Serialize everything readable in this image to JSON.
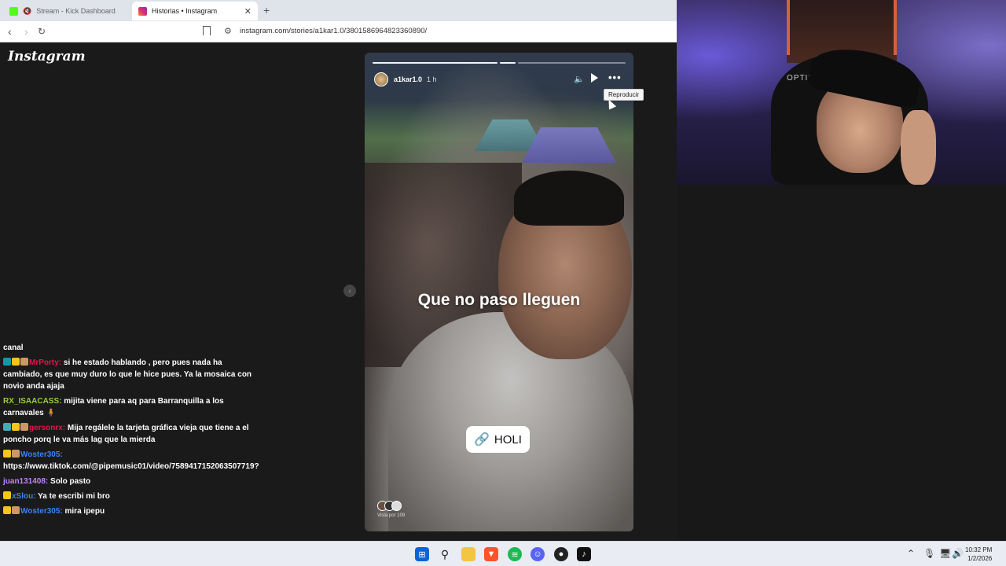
{
  "browser": {
    "tabs": [
      {
        "label": "Stream - Kick Dashboard",
        "icon": "kick-icon",
        "color": "#53fc18"
      },
      {
        "label": "Historias • Instagram",
        "icon": "instagram-icon",
        "color": "#e1306c"
      }
    ],
    "new_tab": "+",
    "url": "instagram.com/stories/a1kar1.0/3801586964823360890/"
  },
  "instagram": {
    "logo": "Instagram",
    "story": {
      "username": "a1kar1.0",
      "time": "1 h",
      "segments": 2,
      "current_segment": 2,
      "caption": "Que no paso lleguen",
      "link_label": "HOLI",
      "viewers_label": "Vista por 109",
      "tooltip": "Reproducir"
    }
  },
  "chat": [
    {
      "user": "",
      "message": "canal",
      "user_color": "#ffffff"
    },
    {
      "user": "MrPorty:",
      "message": " si he estado hablando , pero pues nada ha cambiado, es que muy duro lo que le hice pues. Ya la mosaica con novio anda ajaja",
      "user_color": "#e8134b",
      "badges": [
        "#19a",
        "#f5c518",
        "#c96"
      ]
    },
    {
      "user": "RX_ISAACASS:",
      "message": " mijita viene para aq para Barranquilla a los carnavales 🧍",
      "user_color": "#9acd32"
    },
    {
      "user": "gersonrx:",
      "message": " Mija regálele la tarjeta gráfica vieja que tiene a el poncho porq le va más lag que la mierda",
      "user_color": "#e8134b",
      "badges": [
        "#4ab",
        "#f5c518",
        "#c96"
      ]
    },
    {
      "user": "Woster305:",
      "message": " https://www.tiktok.com/@pipemusic01/video/7589417152063507719?",
      "user_color": "#3b82f6",
      "badges": [
        "#f5c518",
        "#c96"
      ]
    },
    {
      "user": "juan131408:",
      "message": " Solo pasto",
      "user_color": "#c084fc"
    },
    {
      "user": "xSlou:",
      "message": " Ya te escribi mi bro",
      "user_color": "#3b82f6",
      "badges": [
        "#f5c518"
      ]
    },
    {
      "user": "Woster305:",
      "message": " mira ipepu",
      "user_color": "#3b82f6",
      "badges": [
        "#f5c518",
        "#c96"
      ]
    }
  ],
  "webcam": {
    "chair_brand": "OPTIMUS"
  },
  "taskbar": {
    "time": "10:32 PM",
    "date": "1/2/2026"
  }
}
